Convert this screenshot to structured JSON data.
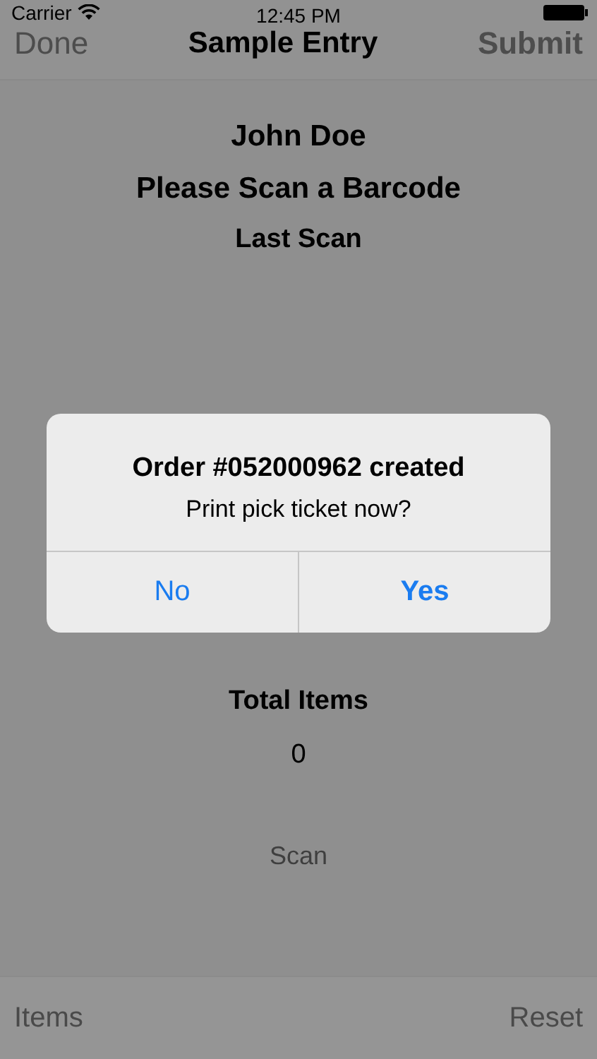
{
  "status_bar": {
    "carrier": "Carrier",
    "time": "12:45 PM"
  },
  "nav_bar": {
    "left_button": "Done",
    "title": "Sample Entry",
    "right_button": "Submit"
  },
  "header": {
    "name": "John Doe",
    "prompt": "Please Scan a Barcode",
    "last_scan_label": "Last Scan"
  },
  "totals": {
    "label": "Total Items",
    "value": "0"
  },
  "scan_button": "Scan",
  "toolbar": {
    "left_button": "Items",
    "right_button": "Reset"
  },
  "alert": {
    "title": "Order #052000962 created",
    "message": "Print pick ticket now?",
    "buttons": [
      {
        "label": "No",
        "preferred": false
      },
      {
        "label": "Yes",
        "preferred": true
      }
    ]
  }
}
